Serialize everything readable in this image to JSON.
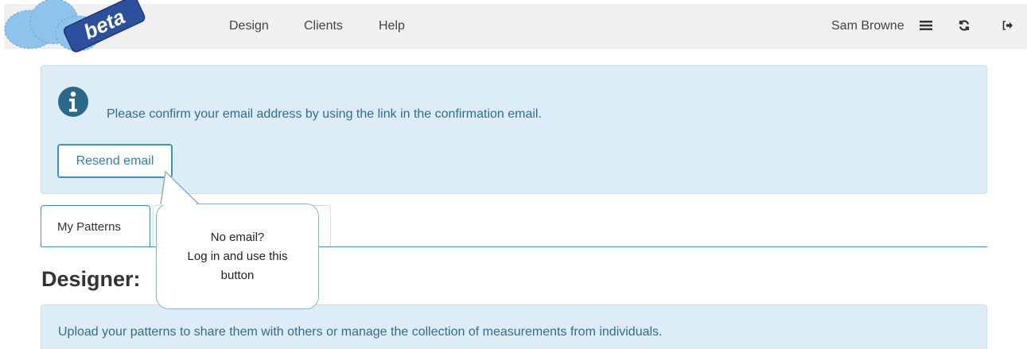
{
  "navbar": {
    "logo_text": "beta",
    "links": [
      "Design",
      "Clients",
      "Help"
    ],
    "user_name": "Sam Browne",
    "icons": [
      "hamburger-icon",
      "refresh-icon",
      "sign-out-icon"
    ]
  },
  "alert": {
    "icon": "info-icon",
    "message": "Please confirm your email address by using the link in the confirmation email.",
    "resend_label": "Resend email"
  },
  "tabs": {
    "active_label": "My Patterns"
  },
  "page": {
    "heading": "Designer:"
  },
  "panel": {
    "text": "Upload your patterns to share them with others or manage the collection of measurements from individuals."
  },
  "callout": {
    "line1": "No email?",
    "line2": "Log in and use this",
    "line3": "button"
  },
  "colors": {
    "accent": "#3c93c6",
    "alert_bg": "#ddedf7",
    "alert_text": "#2f6d8f",
    "navbar_bg": "#f0f0f0"
  }
}
